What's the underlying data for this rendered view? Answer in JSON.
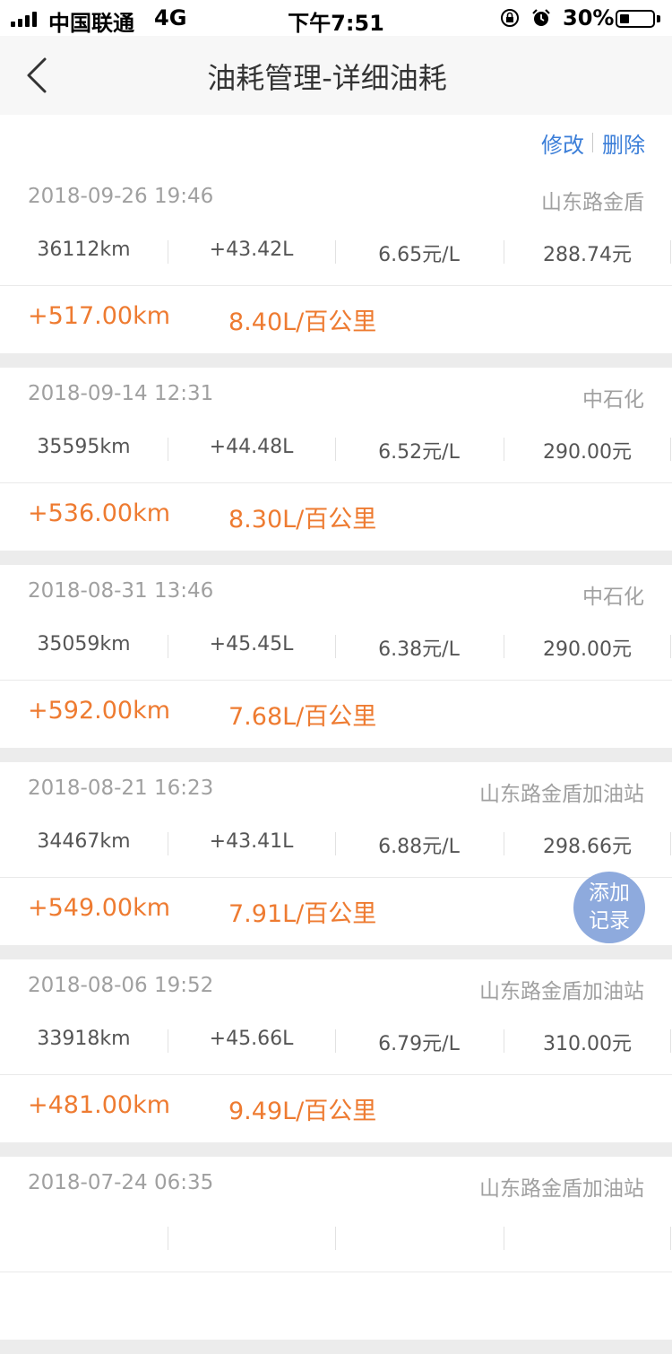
{
  "status_bar": {
    "carrier": "中国联通",
    "network": "4G",
    "time": "下午7:51",
    "battery_percent": "30%",
    "battery_level": 0.3
  },
  "nav": {
    "title": "油耗管理-详细油耗",
    "back_icon": "chevron-left-icon"
  },
  "toolbar": {
    "edit_label": "修改",
    "delete_label": "删除"
  },
  "records": [
    {
      "date": "2018-09-26 19:46",
      "station": "山东路金盾",
      "odometer": "36112km",
      "fuel": "+43.42L",
      "price": "6.65元/L",
      "cost": "288.74元",
      "distance": "+517.00km",
      "consumption": "8.40L/百公里"
    },
    {
      "date": "2018-09-14 12:31",
      "station": "中石化",
      "odometer": "35595km",
      "fuel": "+44.48L",
      "price": "6.52元/L",
      "cost": "290.00元",
      "distance": "+536.00km",
      "consumption": "8.30L/百公里"
    },
    {
      "date": "2018-08-31 13:46",
      "station": "中石化",
      "odometer": "35059km",
      "fuel": "+45.45L",
      "price": "6.38元/L",
      "cost": "290.00元",
      "distance": "+592.00km",
      "consumption": "7.68L/百公里"
    },
    {
      "date": "2018-08-21 16:23",
      "station": "山东路金盾加油站",
      "odometer": "34467km",
      "fuel": "+43.41L",
      "price": "6.88元/L",
      "cost": "298.66元",
      "distance": "+549.00km",
      "consumption": "7.91L/百公里"
    },
    {
      "date": "2018-08-06 19:52",
      "station": "山东路金盾加油站",
      "odometer": "33918km",
      "fuel": "+45.66L",
      "price": "6.79元/L",
      "cost": "310.00元",
      "distance": "+481.00km",
      "consumption": "9.49L/百公里"
    },
    {
      "date": "2018-07-24 06:35",
      "station": "山东路金盾加油站",
      "odometer": "",
      "fuel": "",
      "price": "",
      "cost": "",
      "distance": "",
      "consumption": ""
    }
  ],
  "fab": {
    "line1": "添加",
    "line2": "记录"
  },
  "colors": {
    "accent_blue": "#3b7ed8",
    "orange": "#ee7b31",
    "fab_bg": "#8eaadd"
  }
}
